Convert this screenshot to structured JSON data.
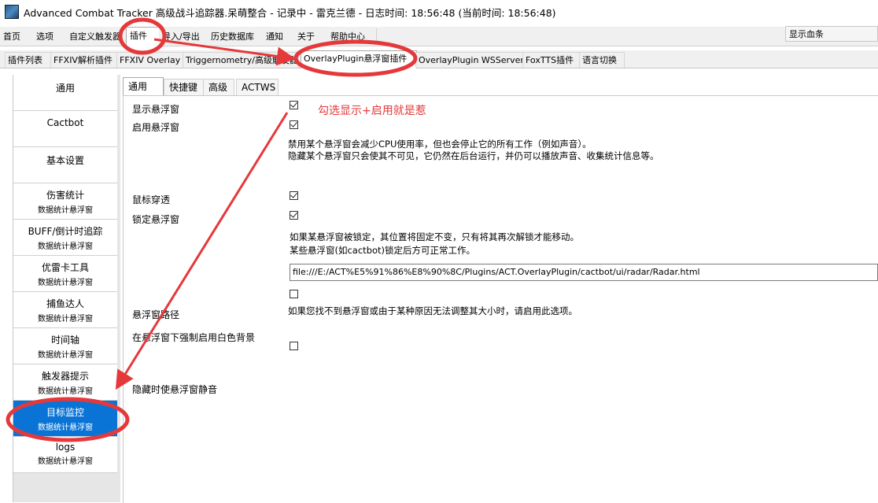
{
  "window": {
    "title": "Advanced Combat Tracker 高级战斗追踪器.呆萌整合 - 记录中 - 雷克兰德 - 日志时间: 18:56:48 (当前时间: 18:56:48)"
  },
  "menubar": {
    "tabs": [
      {
        "label": "首页"
      },
      {
        "label": "选项"
      },
      {
        "label": "自定义触发器"
      },
      {
        "label": "插件"
      },
      {
        "label": "导入/导出"
      },
      {
        "label": "历史数据库"
      },
      {
        "label": "通知"
      },
      {
        "label": "关于"
      },
      {
        "label": "帮助中心"
      }
    ],
    "active_index": 3,
    "dropdown_value": "显示血条"
  },
  "plugin_tabs": {
    "tabs": [
      {
        "label": "插件列表"
      },
      {
        "label": "FFXIV解析插件"
      },
      {
        "label": "FFXIV Overlay"
      },
      {
        "label": "Triggernometry/高级触发器"
      },
      {
        "label": "OverlayPlugin悬浮窗插件"
      },
      {
        "label": "OverlayPlugin WSServer"
      },
      {
        "label": "FoxTTS插件"
      },
      {
        "label": "语言切换"
      }
    ],
    "active_index": 4
  },
  "sidebar": {
    "items": [
      {
        "title": "通用",
        "subtitle": ""
      },
      {
        "title": "Cactbot",
        "subtitle": ""
      },
      {
        "title": "基本设置",
        "subtitle": ""
      },
      {
        "title": "伤害统计",
        "subtitle": "数据统计悬浮窗"
      },
      {
        "title": "BUFF/倒计时追踪",
        "subtitle": "数据统计悬浮窗"
      },
      {
        "title": "优雷卡工具",
        "subtitle": "数据统计悬浮窗"
      },
      {
        "title": "捕鱼达人",
        "subtitle": "数据统计悬浮窗"
      },
      {
        "title": "时间轴",
        "subtitle": "数据统计悬浮窗"
      },
      {
        "title": "触发器提示",
        "subtitle": "数据统计悬浮窗"
      },
      {
        "title": "目标监控",
        "subtitle": "数据统计悬浮窗"
      },
      {
        "title": "logs",
        "subtitle": "数据统计悬浮窗"
      }
    ],
    "active_index": 9
  },
  "content_tabs": {
    "tabs": [
      {
        "label": "通用"
      },
      {
        "label": "快捷键"
      },
      {
        "label": "高级"
      },
      {
        "label": "ACTWS"
      }
    ],
    "active_index": 0
  },
  "settings": {
    "show_overlay": {
      "label": "显示悬浮窗",
      "checked": true
    },
    "enable_overlay": {
      "label": "启用悬浮窗",
      "checked": true
    },
    "enable_desc_1": "禁用某个悬浮窗会减少CPU使用率，但也会停止它的所有工作（例如声音）。",
    "enable_desc_2": "隐藏某个悬浮窗只会使其不可见，它仍然在后台运行，并仍可以播放声音、收集统计信息等。",
    "click_through": {
      "label": "鼠标穿透",
      "checked": true
    },
    "lock_overlay": {
      "label": "锁定悬浮窗",
      "checked": true
    },
    "lock_desc_1": "如果某悬浮窗被锁定，其位置将固定不变，只有将其再次解锁才能移动。",
    "lock_desc_2": " 某些悬浮窗(如cactbot)锁定后方可正常工作。",
    "overlay_path": {
      "label": "悬浮窗路径",
      "value": "file:///E:/ACT%E5%91%86%E8%90%8C/Plugins/ACT.OverlayPlugin/cactbot/ui/radar/Radar.html"
    },
    "white_bg_checkbox": {
      "checked": false
    },
    "white_bg_desc": "如果您找不到悬浮窗或由于某种原因无法调整其大小时，请启用此选项。",
    "force_white_bg": {
      "label": "在悬浮窗下强制启用白色背景",
      "checked": false
    },
    "mute_when_hidden": {
      "label": "隐藏时使悬浮窗静音"
    }
  },
  "annotation": {
    "text": "勾选显示+启用就是惹",
    "color": "#e23b3b"
  },
  "colors": {
    "accent": "#0a74d6",
    "annotation_red": "#e5383b"
  }
}
